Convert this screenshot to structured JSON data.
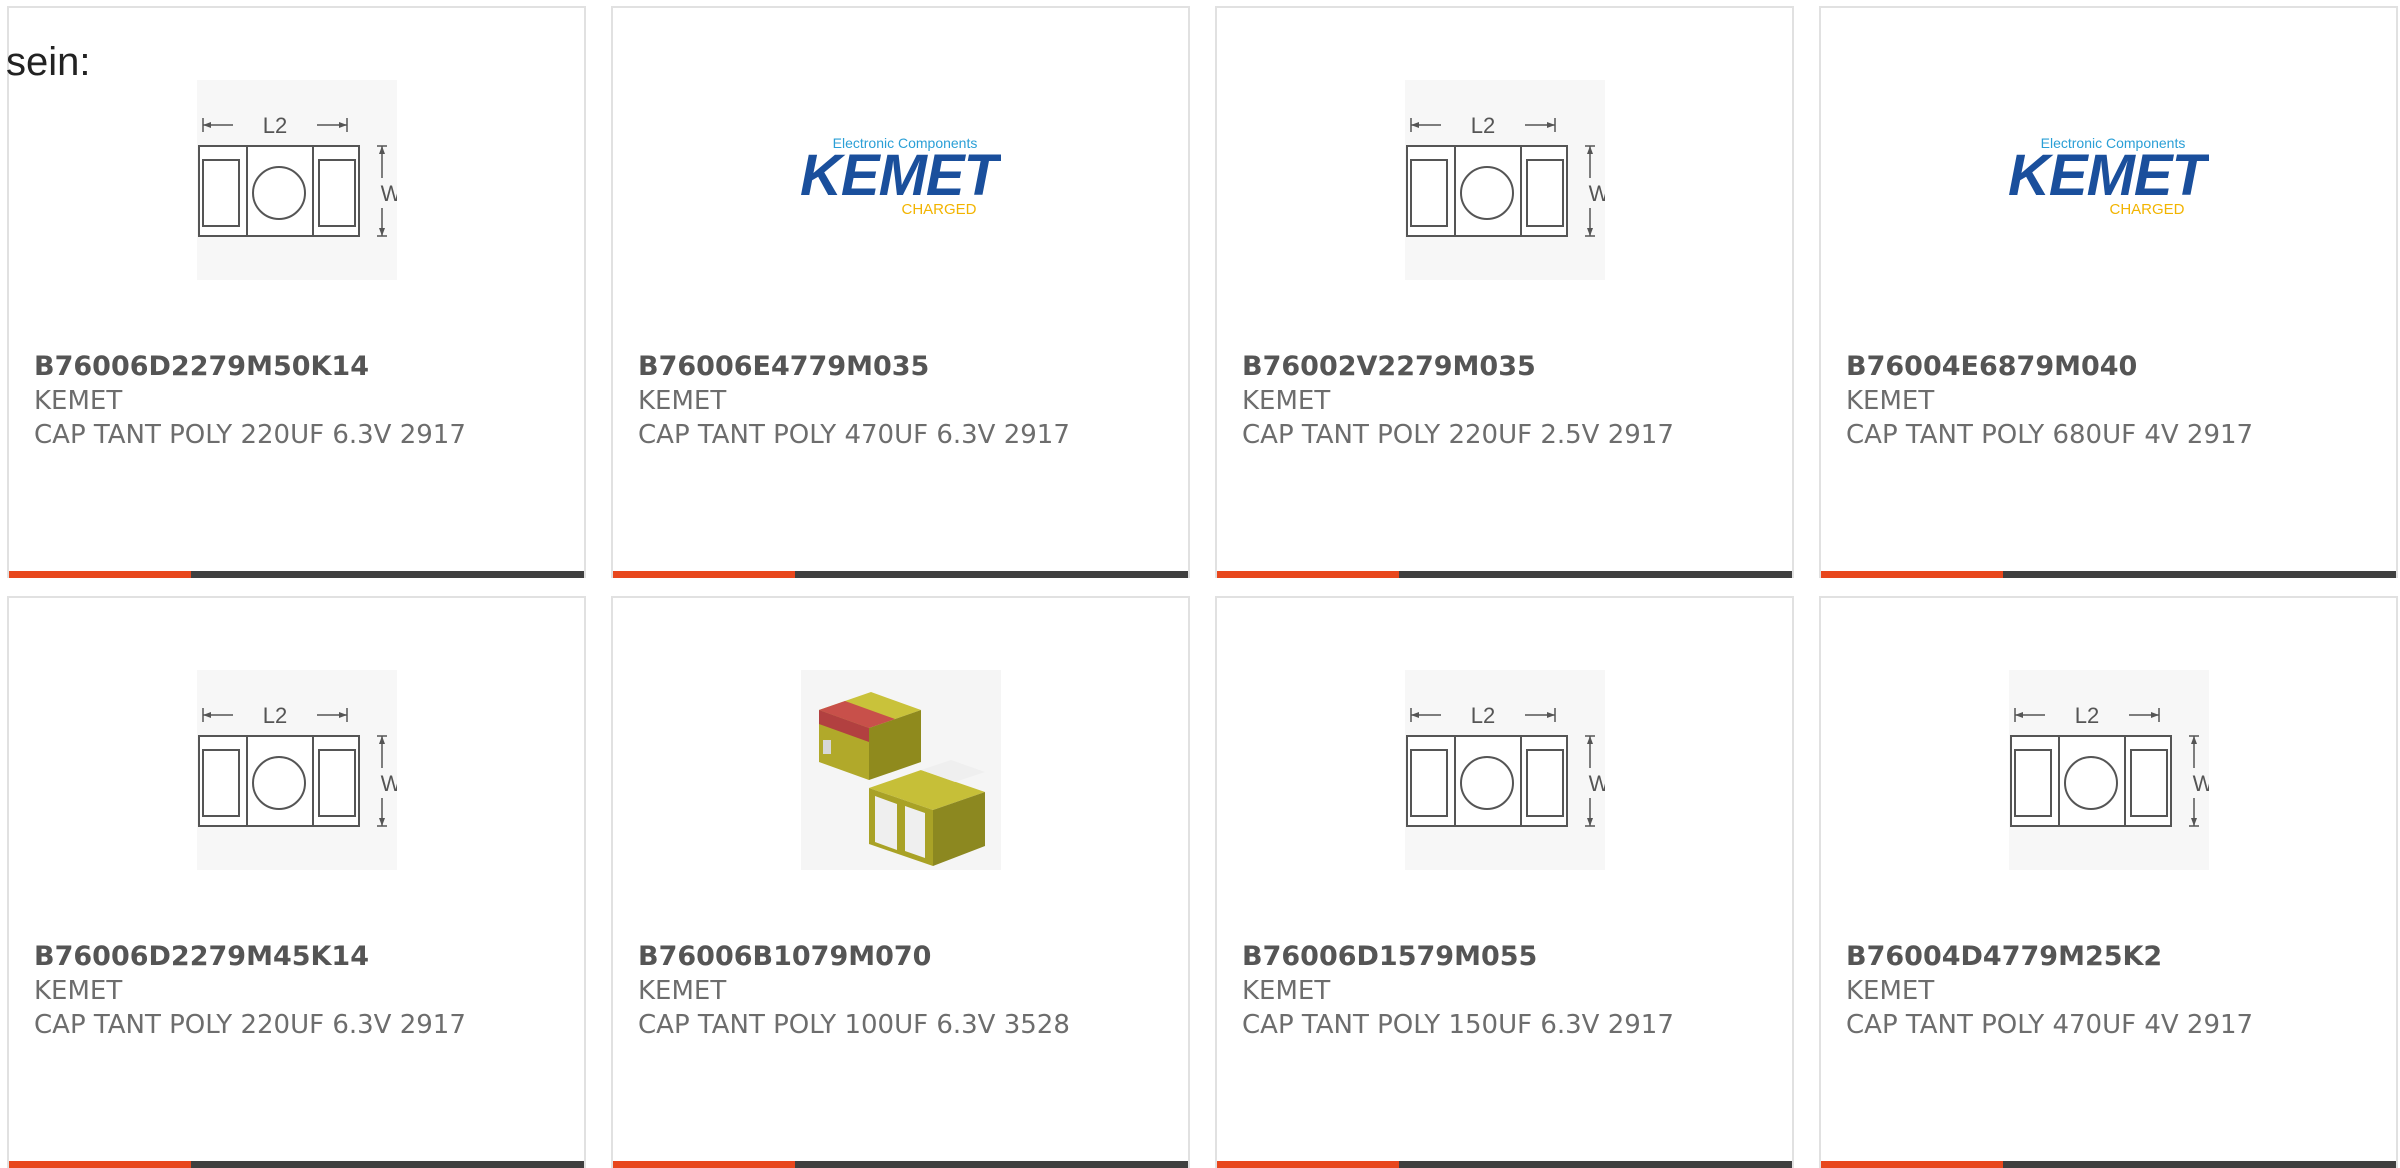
{
  "intro_text": "sein:",
  "brand_colors": {
    "accent": "#e8471d",
    "bar": "#3f3f3f",
    "title": "#555555",
    "text": "#6d6d6d",
    "kemet_blue": "#1a4f9c",
    "kemet_gold": "#f2b400"
  },
  "logo": {
    "tagline": "Electronic Components",
    "name": "KEMET",
    "slogan": "CHARGED"
  },
  "diagram_labels": {
    "length": "L2",
    "width": "W"
  },
  "products": [
    {
      "part": "B76006D2279M50K14",
      "maker": "KEMET",
      "desc": "CAP TANT POLY 220UF 6.3V 2917",
      "image": "dimension-diagram-icon"
    },
    {
      "part": "B76006E4779M035",
      "maker": "KEMET",
      "desc": "CAP TANT POLY 470UF 6.3V 2917",
      "image": "kemet-logo"
    },
    {
      "part": "B76002V2279M035",
      "maker": "KEMET",
      "desc": "CAP TANT POLY 220UF 2.5V 2917",
      "image": "dimension-diagram-icon"
    },
    {
      "part": "B76004E6879M040",
      "maker": "KEMET",
      "desc": "CAP TANT POLY 680UF 4V 2917",
      "image": "kemet-logo"
    },
    {
      "part": "B76006D2279M45K14",
      "maker": "KEMET",
      "desc": "CAP TANT POLY 220UF 6.3V 2917",
      "image": "dimension-diagram-icon"
    },
    {
      "part": "B76006B1079M070",
      "maker": "KEMET",
      "desc": "CAP TANT POLY 100UF 6.3V 3528",
      "image": "capacitor-photo"
    },
    {
      "part": "B76006D1579M055",
      "maker": "KEMET",
      "desc": "CAP TANT POLY 150UF 6.3V 2917",
      "image": "dimension-diagram-icon"
    },
    {
      "part": "B76004D4779M25K2",
      "maker": "KEMET",
      "desc": "CAP TANT POLY 470UF 4V 2917",
      "image": "dimension-diagram-icon"
    }
  ]
}
